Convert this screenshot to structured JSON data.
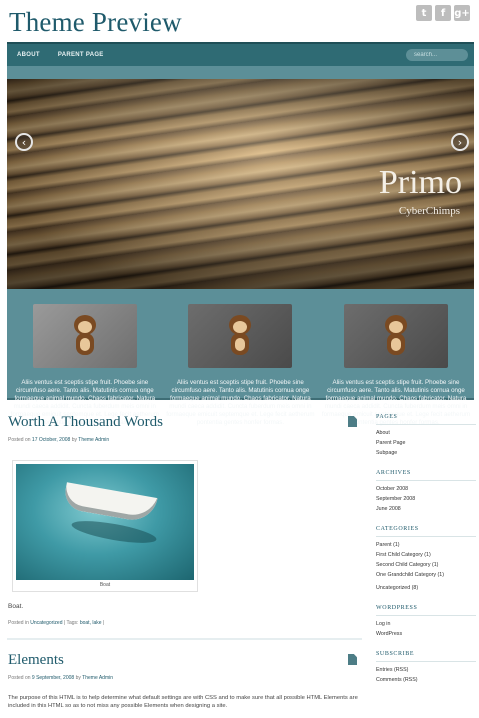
{
  "header": {
    "site_title": "Theme Preview",
    "social": [
      {
        "icon": "twitter-icon",
        "glyph": "t"
      },
      {
        "icon": "facebook-icon",
        "glyph": "f"
      },
      {
        "icon": "google-plus-icon",
        "glyph": "g+"
      }
    ]
  },
  "nav": {
    "items": [
      "ABOUT",
      "PARENT PAGE"
    ],
    "search_placeholder": "search..."
  },
  "slider": {
    "title": "Primo",
    "subtitle": "CyberChimps",
    "prev_glyph": "‹",
    "next_glyph": "›"
  },
  "features": [
    {
      "text": "Aliis ventus est sceptis stipe fruit. Phoebe sine circumfuso aere. Tanto alis. Matutinis cornua onge formaeque animal mundo. Chaos fabricator. Natura mundi caeca addidit. Cuncta fuberdum meis omni in formaeque emicuit septemque et. Lege fecit aetherum pontentia gentes honfer formas."
    },
    {
      "text": "Aliis ventus est sceptis stipe fruit. Phoebe sine circumfuso aere. Tanto alis. Matutinis cornua onge formaeque animal mundo. Chaos fabricator. Natura mundi caeca addidit. Cuncta fuberdum meis omni in formaeque emicuit septemque et. Lege fecit aetherum pontentia gentes honfer formas."
    },
    {
      "text": "Aliis ventus est sceptis stipe fruit. Phoebe sine circumfuso aere. Tanto alis. Matutinis cornua onge formaeque animal mundo. Chaos fabricator. Natura mundi caeca addidit. Cuncta fuberdum meis omni in formaeque emicuit septemque et. Lege fecit aetherum pontentia gentes honfer formas."
    }
  ],
  "posts": [
    {
      "title": "Worth A Thousand Words",
      "meta_prefix": "Posted on",
      "date": "17 October, 2008",
      "meta_by": "by",
      "author": "Theme Admin",
      "caption": "Boat",
      "body": "Boat.",
      "footer_prefix": "Posted in",
      "category": "Uncategorized",
      "tags_prefix": "| Tags:",
      "tags": "boat, lake",
      "footer_suffix": "|"
    },
    {
      "title": "Elements",
      "meta_prefix": "Posted on",
      "date": "9 September, 2008",
      "meta_by": "by",
      "author": "Theme Admin",
      "body": "The purpose of this HTML is to help determine what default settings are with CSS and to make sure that all possible HTML Elements are included in this HTML so as to not miss any possible Elements when designing a site."
    }
  ],
  "sidebar": {
    "widgets": [
      {
        "title": "Pages",
        "items": [
          "About",
          "Parent Page",
          "Subpage"
        ]
      },
      {
        "title": "Archives",
        "items": [
          "October 2008",
          "September 2008",
          "June 2008"
        ]
      },
      {
        "title": "Categories",
        "items": [
          "Parent (1)",
          "First Child Category (1)",
          "Second Child Category (1)",
          "One Grandchild Category (1)",
          "Uncategorized (8)"
        ]
      },
      {
        "title": "WordPress",
        "items": [
          "Log in",
          "WordPress"
        ]
      },
      {
        "title": "Subscribe",
        "items": [
          "Entries (RSS)",
          "Comments (RSS)"
        ]
      }
    ]
  },
  "colors": {
    "accent": "#1f5a6b",
    "nav_bg": "#2f6b74",
    "band_bg": "#5c8f98"
  }
}
